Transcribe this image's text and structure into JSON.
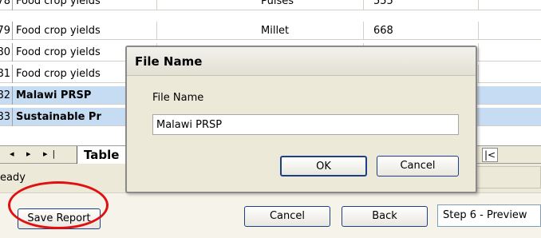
{
  "grid": {
    "rows": [
      {
        "num": "78",
        "name": "Food crop yields",
        "crop": "Pulses",
        "value": "555",
        "selected": false,
        "bold": false
      },
      {
        "num": "79",
        "name": "Food crop yields",
        "crop": "Millet",
        "value": "668",
        "selected": false,
        "bold": false
      },
      {
        "num": "80",
        "name": "Food crop yields",
        "crop": "",
        "value": "",
        "selected": false,
        "bold": false
      },
      {
        "num": "81",
        "name": "Food crop yields",
        "crop": "",
        "value": "",
        "selected": false,
        "bold": false
      },
      {
        "num": "82",
        "name": "Malawi PRSP",
        "crop": "",
        "value": "",
        "selected": true,
        "bold": true
      },
      {
        "num": "83",
        "name": "Sustainable Pr",
        "crop": "",
        "value": "",
        "selected": true,
        "bold": true
      }
    ]
  },
  "tabs": {
    "nav_glyphs": "◂ ▸ ▸|",
    "active_label": "Table"
  },
  "status": {
    "text": "eady"
  },
  "toolbar": {
    "save_label": "Save Report",
    "cancel_label": "Cancel",
    "back_label": "Back",
    "step_value": "Step 6 - Preview"
  },
  "dialog": {
    "title": "File Name",
    "field_label": "File Name",
    "field_value": "Malawi PRSP",
    "ok_label": "OK",
    "cancel_label": "Cancel"
  },
  "colors": {
    "selection": "#c6dcf3",
    "annotation": "#e01010",
    "button_border": "#1c3f86"
  }
}
